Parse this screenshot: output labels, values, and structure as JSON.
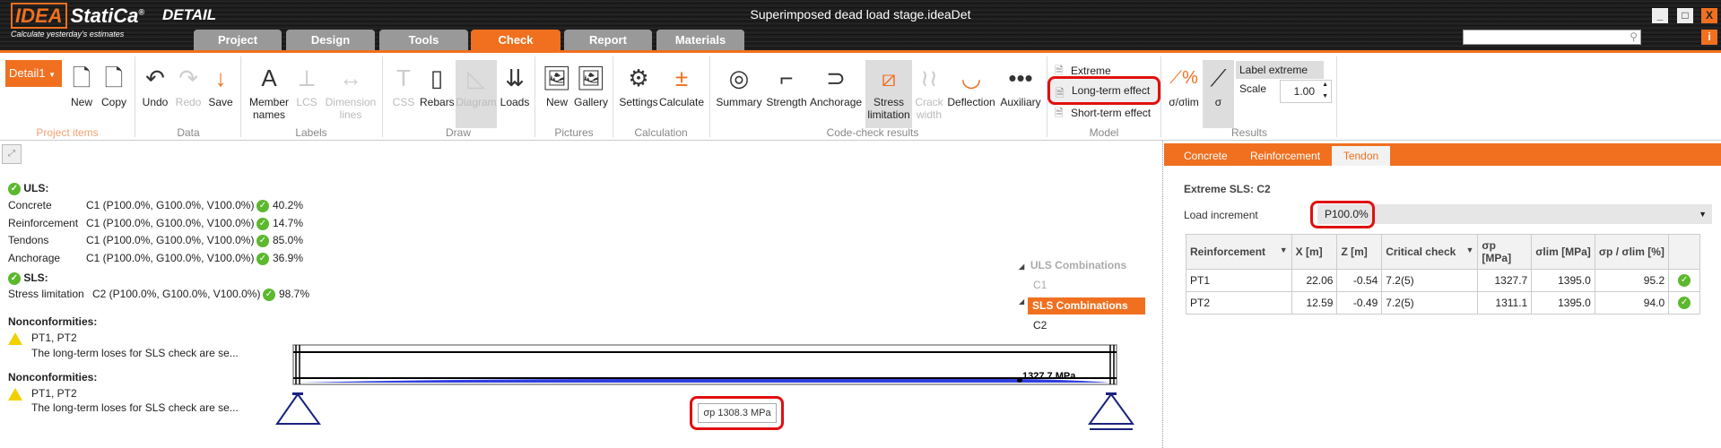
{
  "app": {
    "logo": "IDEA StatiCa",
    "logo_reg": "®",
    "product": "DETAIL",
    "slogan": "Calculate yesterday's estimates",
    "window_title": "Superimposed dead load stage.ideaDet"
  },
  "window": {
    "minimize": "_",
    "maximize": "□",
    "close": "X",
    "info": "i"
  },
  "tabs": [
    {
      "label": "Project"
    },
    {
      "label": "Design"
    },
    {
      "label": "Tools"
    },
    {
      "label": "Check",
      "active": true
    },
    {
      "label": "Report"
    },
    {
      "label": "Materials"
    }
  ],
  "accent": "#f07020",
  "ribbon": {
    "project_items": {
      "label": "Project items",
      "dropdown": "Detail1",
      "new": "New",
      "copy": "Copy"
    },
    "data": {
      "label": "Data",
      "undo": "Undo",
      "redo": "Redo",
      "save": "Save"
    },
    "labels": {
      "label": "Labels",
      "member_names": "Member names",
      "lcs": "LCS",
      "dimension_lines": "Dimension lines"
    },
    "draw": {
      "label": "Draw",
      "css": "CSS",
      "rebars": "Rebars",
      "diagram": "Diagram",
      "loads": "Loads"
    },
    "pictures": {
      "label": "Pictures",
      "new": "New",
      "gallery": "Gallery"
    },
    "calculation": {
      "label": "Calculation",
      "settings": "Settings",
      "calculate": "Calculate"
    },
    "code_check": {
      "label": "Code-check results",
      "summary": "Summary",
      "strength": "Strength",
      "anchorage": "Anchorage",
      "stress_limitation": "Stress limitation",
      "crack_width": "Crack width",
      "deflection": "Deflection",
      "auxiliary": "Auxiliary"
    },
    "model": {
      "label": "Model",
      "extreme": "Extreme",
      "long_term": "Long-term effect",
      "short_term": "Short-term effect"
    },
    "results": {
      "label": "Results",
      "sigma_ratio": "σ/σlim",
      "sigma": "σ",
      "label_extreme": "Label extreme",
      "scale_label": "Scale",
      "scale_value": "1.00"
    }
  },
  "summary": {
    "uls_title": "ULS:",
    "uls": [
      {
        "name": "Concrete",
        "combo": "C1 (P100.0%, G100.0%, V100.0%)",
        "value": "40.2%"
      },
      {
        "name": "Reinforcement",
        "combo": "C1 (P100.0%, G100.0%, V100.0%)",
        "value": "14.7%"
      },
      {
        "name": "Tendons",
        "combo": "C1 (P100.0%, G100.0%, V100.0%)",
        "value": "85.0%"
      },
      {
        "name": "Anchorage",
        "combo": "C1 (P100.0%, G100.0%, V100.0%)",
        "value": "36.9%"
      }
    ],
    "sls_title": "SLS:",
    "sls": [
      {
        "name": "Stress limitation",
        "combo": "C2 (P100.0%, G100.0%, V100.0%)",
        "value": "98.7%"
      }
    ],
    "nonconformities": [
      {
        "title": "Nonconformities:",
        "items": "PT1, PT2",
        "text": "The long-term loses for SLS check are se..."
      },
      {
        "title": "Nonconformities:",
        "items": "PT1, PT2",
        "text": "The long-term loses for SLS check are se..."
      }
    ]
  },
  "combinations": {
    "uls_title": "ULS Combinations",
    "uls": [
      "C1"
    ],
    "sls_title": "SLS Combinations",
    "sls": [
      "C2"
    ]
  },
  "diagram": {
    "max_label": "1327.7 MPa",
    "tooltip": "σp 1308.3 MPa",
    "tendon_color": "#2030e0"
  },
  "right_panel": {
    "tabs": [
      "Concrete",
      "Reinforcement",
      "Tendon"
    ],
    "active_tab": "Tendon",
    "title": "Extreme SLS: C2",
    "load_increment_label": "Load increment",
    "load_increment_value": "P100.0%",
    "columns": [
      "Reinforcement",
      "X [m]",
      "Z [m]",
      "Critical check",
      "σp [MPa]",
      "σlim [MPa]",
      "σp / σlim [%]",
      ""
    ],
    "rows": [
      [
        "PT1",
        "22.06",
        "-0.54",
        "7.2(5)",
        "1327.7",
        "1395.0",
        "95.2"
      ],
      [
        "PT2",
        "12.59",
        "-0.49",
        "7.2(5)",
        "1311.1",
        "1395.0",
        "94.0"
      ]
    ]
  }
}
